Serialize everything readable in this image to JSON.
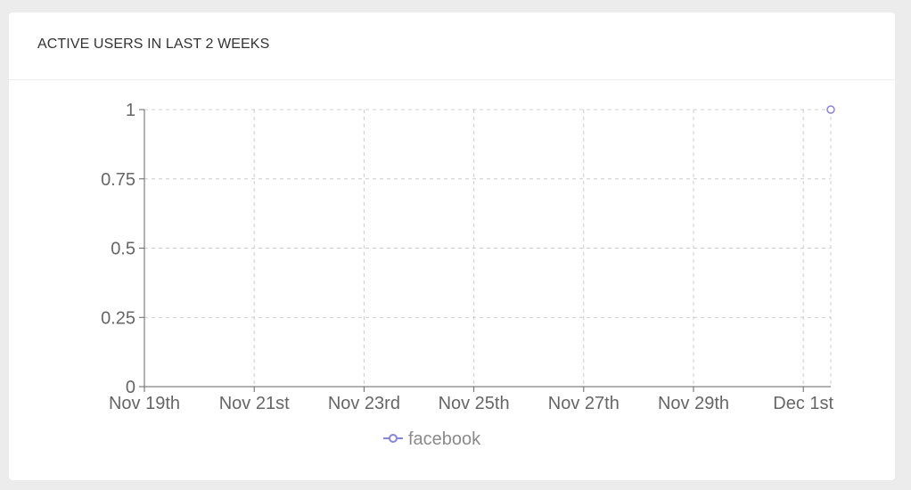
{
  "card": {
    "title": "ACTIVE USERS IN LAST 2 WEEKS"
  },
  "chart_data": {
    "type": "line",
    "title": "ACTIVE USERS IN LAST 2 WEEKS",
    "xlabel": "",
    "ylabel": "",
    "x_tick_labels": [
      "Nov 19th",
      "Nov 21st",
      "Nov 23rd",
      "Nov 25th",
      "Nov 27th",
      "Nov 29th",
      "Dec 1st"
    ],
    "x_ticks": [
      "2016-11-19",
      "2016-11-21",
      "2016-11-23",
      "2016-11-25",
      "2016-11-27",
      "2016-11-29",
      "2016-12-01"
    ],
    "xlim": [
      "2016-11-19",
      "2016-12-01T12:00"
    ],
    "y_ticks": [
      0,
      0.25,
      0.5,
      0.75,
      1
    ],
    "y_tick_labels": [
      "0",
      "0.25",
      "0.5",
      "0.75",
      "1"
    ],
    "ylim": [
      0,
      1
    ],
    "grid": true,
    "legend": "bottom-center",
    "series": [
      {
        "name": "facebook",
        "color": "#8884d8",
        "points": [
          {
            "x": "2016-12-01T12:00",
            "y": 1
          }
        ]
      }
    ]
  }
}
